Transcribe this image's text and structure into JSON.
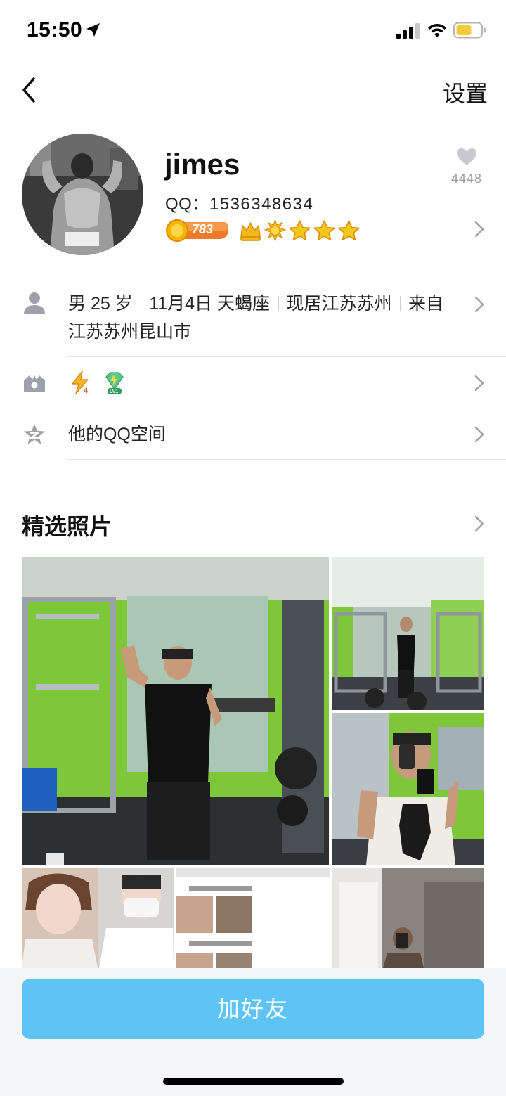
{
  "status_bar": {
    "time": "15:50"
  },
  "nav": {
    "settings_label": "设置"
  },
  "profile": {
    "nickname": "jimes",
    "qq_label": "QQ：",
    "qq_number": "1536348634",
    "vip_points": "783",
    "like_count": "4448"
  },
  "info": {
    "gender_age": "男 25 岁",
    "birthday": "11月4日 天蝎座",
    "residence": "现居江苏苏州",
    "hometown": "来自江苏苏州昆山市",
    "qzone_label": "他的QQ空间"
  },
  "photos": {
    "section_title": "精选照片"
  },
  "actions": {
    "add_friend_label": "加好友"
  },
  "colors": {
    "accent": "#5ec4f5",
    "background": "#ffffff",
    "bottom_bar": "#f5f6fa"
  }
}
